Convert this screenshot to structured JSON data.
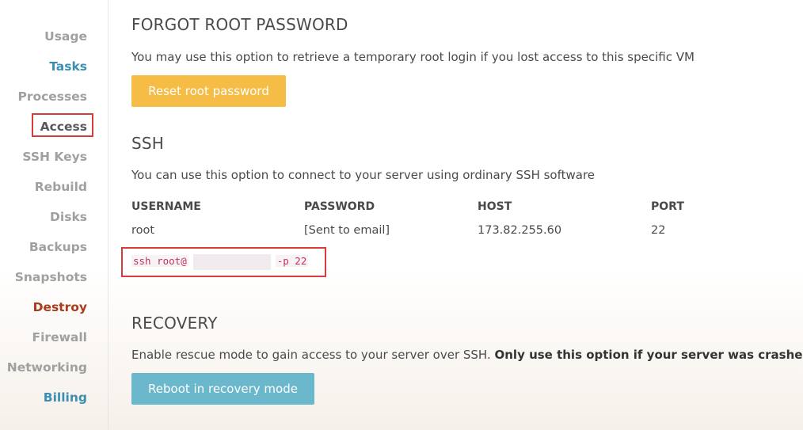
{
  "sidebar": {
    "items": [
      {
        "label": "Usage",
        "style": "muted"
      },
      {
        "label": "Tasks",
        "style": "link"
      },
      {
        "label": "Processes",
        "style": "muted"
      },
      {
        "label": "Access",
        "style": "active"
      },
      {
        "label": "SSH Keys",
        "style": "muted"
      },
      {
        "label": "Rebuild",
        "style": "muted"
      },
      {
        "label": "Disks",
        "style": "muted"
      },
      {
        "label": "Backups",
        "style": "muted"
      },
      {
        "label": "Snapshots",
        "style": "muted"
      },
      {
        "label": "Destroy",
        "style": "danger"
      },
      {
        "label": "Firewall",
        "style": "muted"
      },
      {
        "label": "Networking",
        "style": "muted"
      },
      {
        "label": "Billing",
        "style": "link"
      }
    ]
  },
  "forgot": {
    "title": "FORGOT ROOT PASSWORD",
    "description": "You may use this option to retrieve a temporary root login if you lost access to this specific VM",
    "button": "Reset root password"
  },
  "ssh": {
    "title": "SSH",
    "description": "You can use this option to connect to your server using ordinary SSH software",
    "columns": [
      "USERNAME",
      "PASSWORD",
      "HOST",
      "PORT"
    ],
    "values": [
      "root",
      "[Sent to email]",
      "173.82.255.60",
      "22"
    ],
    "command_prefix": "ssh root@",
    "command_suffix": "-p 22"
  },
  "recovery": {
    "title": "RECOVERY",
    "description": "Enable rescue mode to gain access to your server over SSH.",
    "description_strong": "Only use this option if your server was crashed",
    "button": "Reboot in recovery mode"
  },
  "colors": {
    "link": "#3b8fb0",
    "danger": "#a63c1a",
    "highlight_border": "#d93a3a",
    "yellow_button": "#f5bd45",
    "blue_button": "#6bb8cc"
  }
}
